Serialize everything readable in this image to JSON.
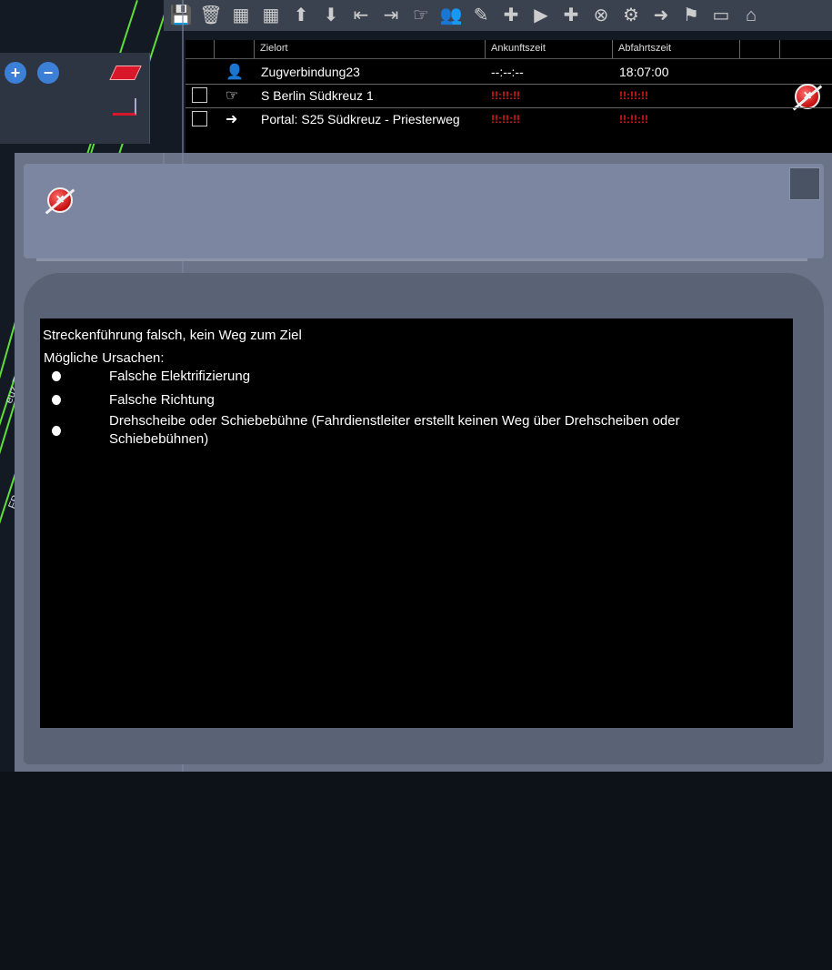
{
  "map": {
    "label": "FB Berlin Südkreuz",
    "label2": "euz 7"
  },
  "toolbar": {
    "buttons": [
      {
        "icon": "save-icon",
        "glyph": "💾"
      },
      {
        "icon": "trash-icon",
        "glyph": "🗑"
      },
      {
        "icon": "grid-icon",
        "glyph": "▦"
      },
      {
        "icon": "green-grid-icon",
        "glyph": "▦"
      },
      {
        "icon": "move-up-icon",
        "glyph": "⬆"
      },
      {
        "icon": "move-down-icon",
        "glyph": "⬇"
      },
      {
        "icon": "insert-before-icon",
        "glyph": "⇤"
      },
      {
        "icon": "insert-after-icon",
        "glyph": "⇥"
      },
      {
        "icon": "pointer-hand-icon",
        "glyph": "☞"
      },
      {
        "icon": "conductor-icon",
        "glyph": "👥"
      },
      {
        "icon": "edit-schedule-icon",
        "glyph": "✎"
      },
      {
        "icon": "crossing-icon",
        "glyph": "✚"
      },
      {
        "icon": "add-waypoint-icon",
        "glyph": "▶"
      },
      {
        "icon": "add-green-icon",
        "glyph": "✚"
      },
      {
        "icon": "remove-route-icon",
        "glyph": "⊗"
      },
      {
        "icon": "settings-icon",
        "glyph": "⚙"
      },
      {
        "icon": "portal-icon",
        "glyph": "➜"
      },
      {
        "icon": "flag-icon",
        "glyph": "⚑"
      },
      {
        "icon": "keyboard-icon",
        "glyph": "▭"
      },
      {
        "icon": "station-icon",
        "glyph": "⌂"
      }
    ]
  },
  "schedule": {
    "columns": [
      "Zielort",
      "Ankunftszeit",
      "Abfahrtszeit"
    ],
    "rows": [
      {
        "icon": "conductor-icon",
        "glyph": "👤",
        "destination": "Zugverbindung23",
        "arrival": "--:--:--",
        "departure": "18:07:00",
        "checkbox": false,
        "error": false
      },
      {
        "icon": "pointer-hand-icon",
        "glyph": "☞",
        "destination": "S Berlin Südkreuz 1",
        "arrival": "!!:!!:!!",
        "departure": "!!:!!:!!",
        "checkbox": true,
        "error": true
      },
      {
        "icon": "portal-icon",
        "glyph": "➜",
        "destination": "Portal: S25 Südkreuz - Priesterweg",
        "arrival": "!!:!!:!!",
        "departure": "!!:!!:!!",
        "checkbox": true,
        "error": false
      }
    ]
  },
  "message": {
    "title": "Streckenführung falsch, kein Weg zum Ziel",
    "subtitle": "Mögliche Ursachen:",
    "causes": [
      "Falsche Elektrifizierung",
      "Falsche Richtung",
      "Drehscheibe oder Schiebebühne (Fahrdienstleiter erstellt keinen Weg über Drehscheiben oder Schiebebühnen)"
    ]
  },
  "colors": {
    "map_line": "#5dde3a",
    "error_red": "#e31818",
    "dialog_frame": "#6a7387"
  }
}
